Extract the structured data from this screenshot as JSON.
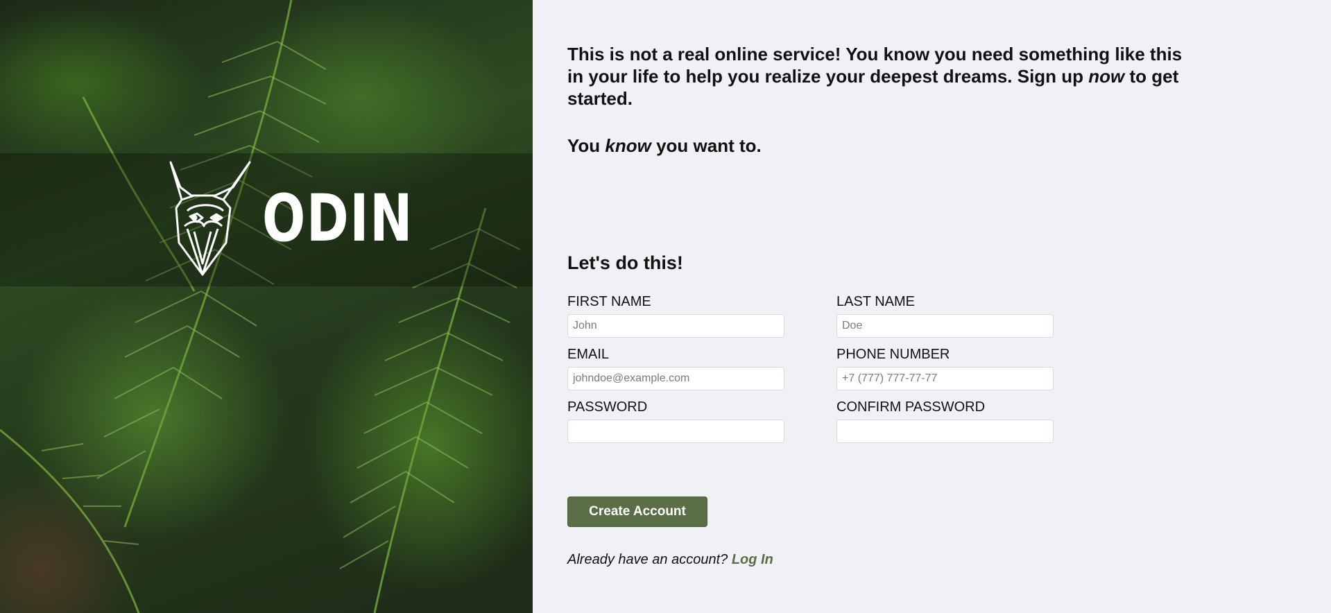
{
  "brand": {
    "name": "ODIN"
  },
  "intro": {
    "p1_before": "This is not a real online service! You know you need something like this in your life to help you realize your deepest dreams. Sign up ",
    "p1_emph": "now",
    "p1_after": " to get started.",
    "p2_before": "You ",
    "p2_emph": "know",
    "p2_after": " you want to."
  },
  "form": {
    "title": "Let's do this!",
    "fields": [
      {
        "label": "FIRST NAME",
        "placeholder": "John",
        "value": ""
      },
      {
        "label": "LAST NAME",
        "placeholder": "Doe",
        "value": ""
      },
      {
        "label": "EMAIL",
        "placeholder": "johndoe@example.com",
        "value": ""
      },
      {
        "label": "PHONE NUMBER",
        "placeholder": "+7 (777) 777-77-77",
        "value": ""
      },
      {
        "label": "PASSWORD",
        "placeholder": "",
        "value": ""
      },
      {
        "label": "CONFIRM PASSWORD",
        "placeholder": "",
        "value": ""
      }
    ],
    "submit_label": "Create Account"
  },
  "login": {
    "prompt": "Already have an account? ",
    "link_label": "Log In"
  },
  "colors": {
    "accent": "#5a6e46",
    "background": "#eff1f5"
  },
  "icons": {
    "logo": "odin-viking-head-icon"
  }
}
